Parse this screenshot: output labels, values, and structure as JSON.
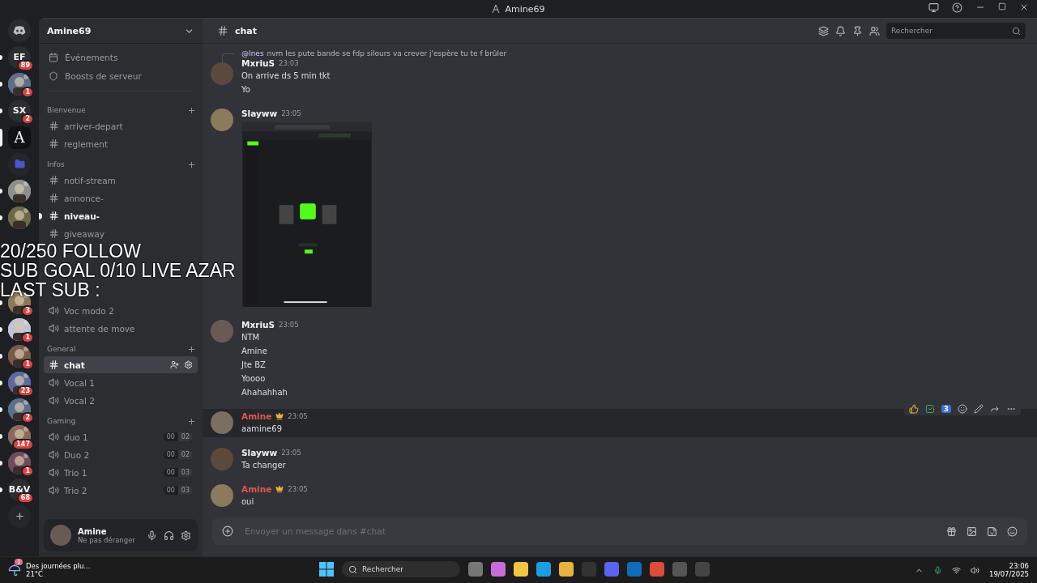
{
  "window": {
    "title": "Amine69"
  },
  "servers": [
    {
      "kind": "logo",
      "selected": false,
      "unread": false
    },
    {
      "kind": "text",
      "label": "EF",
      "badge": "89",
      "selected": false,
      "unread": true
    },
    {
      "kind": "picture",
      "badge": "1",
      "selected": false,
      "unread": true
    },
    {
      "kind": "text",
      "label": "SX",
      "badge": "2",
      "selected": false,
      "unread": true
    },
    {
      "kind": "text",
      "label": "A",
      "selected": true,
      "unread": false
    },
    {
      "kind": "folder",
      "selected": false,
      "unread": false
    },
    {
      "kind": "picture",
      "selected": false,
      "unread": true
    },
    {
      "kind": "picture",
      "selected": false,
      "unread": true
    },
    {
      "kind": "picture",
      "badge": "3",
      "selected": false,
      "unread": true
    },
    {
      "kind": "picture",
      "badge": "1",
      "selected": false,
      "unread": true
    },
    {
      "kind": "picture",
      "badge": "1",
      "selected": false,
      "unread": true
    },
    {
      "kind": "picture",
      "badge": "23",
      "selected": false,
      "unread": true
    },
    {
      "kind": "picture",
      "badge": "2",
      "selected": false,
      "unread": true
    },
    {
      "kind": "picture",
      "badge": "147",
      "selected": false,
      "unread": true
    },
    {
      "kind": "picture",
      "badge": "1",
      "selected": false,
      "unread": true
    },
    {
      "kind": "text",
      "label": "B&V",
      "badge": "68",
      "selected": false,
      "unread": true
    },
    {
      "kind": "add",
      "selected": false,
      "unread": false
    }
  ],
  "sidebar": {
    "server_name": "Amine69",
    "top_items": [
      {
        "kind": "events",
        "label": "Événements"
      },
      {
        "kind": "boosts",
        "label": "Boosts de serveur"
      }
    ],
    "categories": [
      {
        "name": "Bienvenue",
        "channels": [
          {
            "kind": "text",
            "name": "arriver-depart",
            "selected": false,
            "unread": false
          },
          {
            "kind": "text",
            "name": "reglement",
            "selected": false,
            "unread": false
          }
        ]
      },
      {
        "name": "Infos",
        "channels": [
          {
            "kind": "text",
            "name": "notif-stream",
            "selected": false,
            "unread": false
          },
          {
            "kind": "text",
            "name": "annonce-",
            "selected": false,
            "unread": false
          },
          {
            "kind": "text",
            "name": "niveau-",
            "selected": false,
            "unread": true
          },
          {
            "kind": "text",
            "name": "giveaway",
            "selected": false,
            "unread": false
          }
        ]
      },
      {
        "channels": [
          {
            "kind": "voice",
            "name": "Voc modo 2",
            "selected": false,
            "unread": false
          },
          {
            "kind": "voice",
            "name": "attente de move",
            "selected": false,
            "unread": false
          }
        ]
      },
      {
        "name": "General",
        "channels": [
          {
            "kind": "text",
            "name": "chat",
            "selected": true,
            "unread": false
          },
          {
            "kind": "voice",
            "name": "Vocal 1",
            "selected": false,
            "unread": false
          },
          {
            "kind": "voice",
            "name": "Vocal 2",
            "selected": false,
            "unread": false
          }
        ]
      },
      {
        "name": "Gaming",
        "channels": [
          {
            "kind": "voice",
            "name": "duo 1",
            "selected": false,
            "unread": false,
            "count": "00",
            "limit": "02"
          },
          {
            "kind": "voice",
            "name": "Duo 2",
            "selected": false,
            "unread": false,
            "count": "00",
            "limit": "02"
          },
          {
            "kind": "voice",
            "name": "Trio 1",
            "selected": false,
            "unread": false,
            "count": "00",
            "limit": "03"
          },
          {
            "kind": "voice",
            "name": "Trio 2",
            "selected": false,
            "unread": false,
            "count": "00",
            "limit": "03"
          }
        ]
      }
    ],
    "user": {
      "name": "Amine",
      "status": "Ne pas déranger"
    }
  },
  "channel": {
    "name": "chat",
    "search_placeholder": "Rechercher"
  },
  "messages": [
    {
      "author": "MxriuS",
      "color": "#f2f3f5",
      "crown": false,
      "time": "23:03",
      "highlighted": false,
      "reply": {
        "mention": "@Ines",
        "text": "nvm les pute bande se fdp silours va crever j'espère tu te f brûler"
      },
      "lines": [
        "On arrive ds 5 min tkt",
        "Yo"
      ]
    },
    {
      "author": "Slayww",
      "color": "#f2f3f5",
      "crown": false,
      "time": "23:05",
      "highlighted": false,
      "attachment": {
        "kind": "picture"
      }
    },
    {
      "author": "MxriuS",
      "color": "#f2f3f5",
      "crown": false,
      "time": "23:05",
      "highlighted": false,
      "lines": [
        "NTM",
        "Amine",
        "Jte BZ",
        "Yoooo",
        "Ahahahhah"
      ]
    },
    {
      "author": "Amine",
      "color": "#e0584f",
      "crown": true,
      "time": "23:05",
      "highlighted": true,
      "toolbar": {
        "badge": "3"
      },
      "lines": [
        "aamine69"
      ]
    },
    {
      "author": "Slayww",
      "color": "#f2f3f5",
      "crown": false,
      "time": "23:05",
      "highlighted": false,
      "lines": [
        "Ta changer"
      ]
    },
    {
      "author": "Amine",
      "color": "#e0584f",
      "crown": true,
      "time": "23:05",
      "highlighted": false,
      "lines": [
        "oui"
      ]
    }
  ],
  "composer": {
    "placeholder": "Envoyer un message dans #chat"
  },
  "stream_overlay": [
    "20/250 FOLLOW",
    "SUB GOAL 0/10 LIVE AZAR",
    "LAST SUB :"
  ],
  "taskbar": {
    "weather": "Des journées plu...",
    "temperature": "21°C",
    "weather_badge": "1",
    "search_placeholder": "Rechercher",
    "time": "23:06",
    "date": "19/07/2025"
  }
}
